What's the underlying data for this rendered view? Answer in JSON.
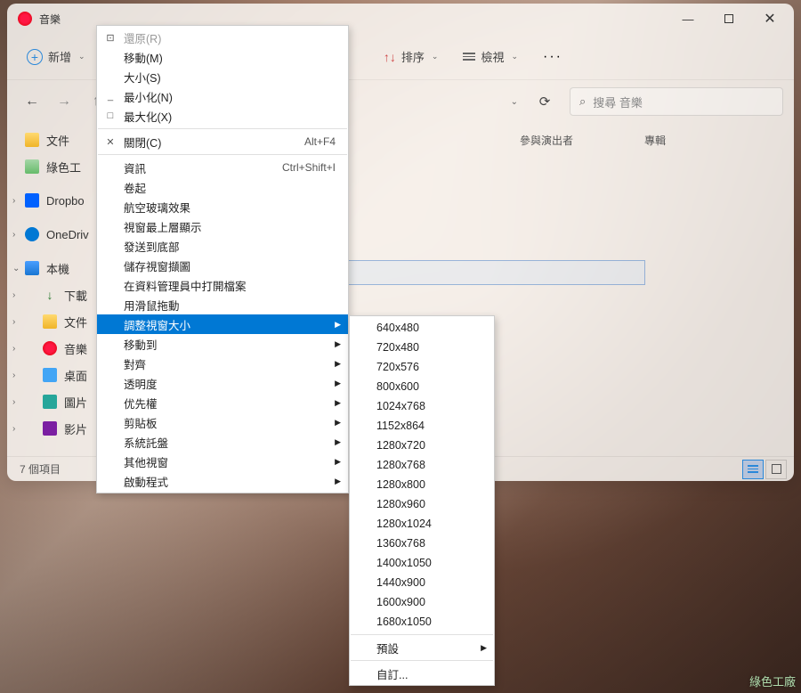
{
  "window": {
    "title": "音樂"
  },
  "toolbar": {
    "new_label": "新增",
    "sort_label": "排序",
    "view_label": "檢視"
  },
  "search": {
    "placeholder": "搜尋 音樂"
  },
  "sidebar": {
    "docs": "文件",
    "green": "綠色工",
    "dropbox": "Dropbo",
    "onedrive": "OneDriv",
    "pc": "本機",
    "downloads": "下載",
    "docs2": "文件",
    "music": "音樂",
    "desktop": "桌面",
    "pics": "圖片",
    "video": "影片"
  },
  "columns": {
    "artist": "參與演出者",
    "album": "專輯"
  },
  "empty_msg": "",
  "statusbar": {
    "count": "7 個項目"
  },
  "menu1": {
    "restore": "還原(R)",
    "move": "移動(M)",
    "size": "大小(S)",
    "minimize": "最小化(N)",
    "maximize": "最大化(X)",
    "close": "關閉(C)",
    "close_short": "Alt+F4",
    "info": "資訊",
    "info_short": "Ctrl+Shift+I",
    "rollup": "卷起",
    "aero": "航空玻璃效果",
    "topmost": "視窗最上層顯示",
    "send_bottom": "發送到底部",
    "save_screenshot": "儲存視窗擷圖",
    "open_in_explorer": "在資料管理員中打開檔案",
    "mouse_drag": "用滑鼠拖動",
    "resize": "調整視窗大小",
    "move_to": "移動到",
    "align": "對齊",
    "transparency": "透明度",
    "priority": "优先權",
    "clipboard": "剪貼板",
    "systray": "系統託盤",
    "other_windows": "其他視窗",
    "start_program": "啟動程式"
  },
  "menu2": {
    "sizes": [
      "640x480",
      "720x480",
      "720x576",
      "800x600",
      "1024x768",
      "1152x864",
      "1280x720",
      "1280x768",
      "1280x800",
      "1280x960",
      "1280x1024",
      "1360x768",
      "1400x1050",
      "1440x900",
      "1600x900",
      "1680x1050"
    ],
    "preset": "預設",
    "custom": "自訂..."
  },
  "watermark": "綠色工廠"
}
